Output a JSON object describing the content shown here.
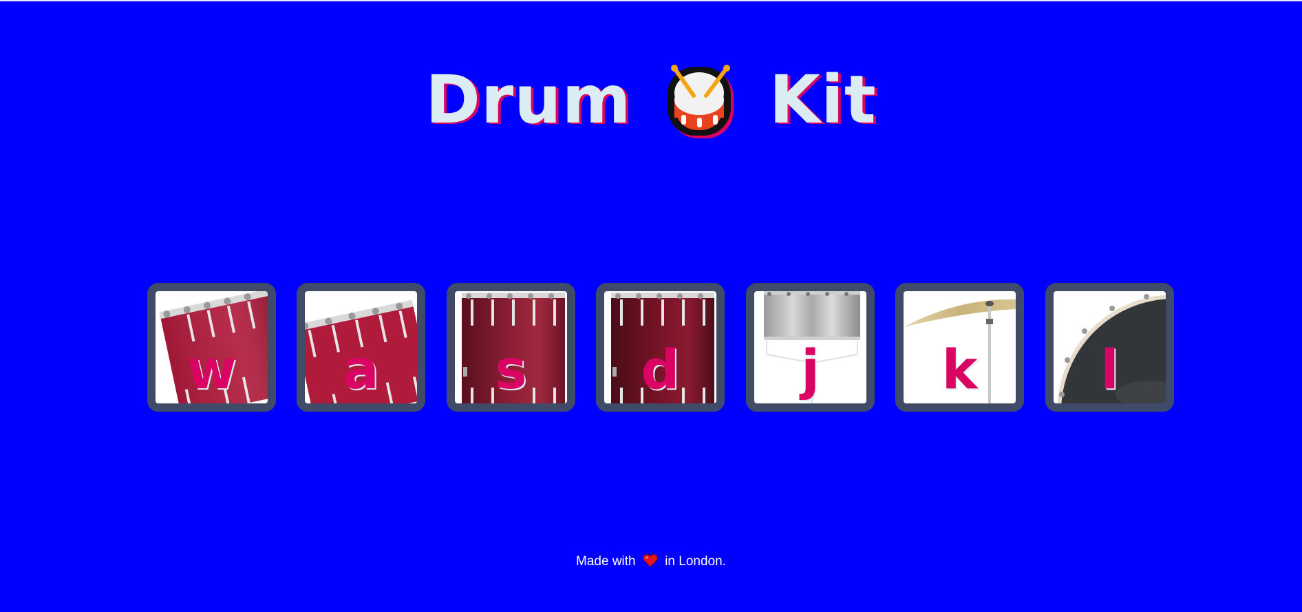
{
  "title": {
    "word1": "Drum",
    "emoji_icon": "drum-emoji-icon",
    "word2": "Kit"
  },
  "drums": [
    {
      "key": "w",
      "icon": "tom-1-icon"
    },
    {
      "key": "a",
      "icon": "tom-2-icon"
    },
    {
      "key": "s",
      "icon": "tom-3-icon"
    },
    {
      "key": "d",
      "icon": "tom-4-icon"
    },
    {
      "key": "j",
      "icon": "snare-icon"
    },
    {
      "key": "k",
      "icon": "crash-cymbal-icon"
    },
    {
      "key": "l",
      "icon": "kick-drum-icon"
    }
  ],
  "footer": {
    "before": "Made with",
    "heart_icon": "heart-icon",
    "after": "in London."
  },
  "colors": {
    "background": "#0000FF",
    "title_text": "#DBEDF3",
    "title_shadow": "#DA0463",
    "key_text": "#DA0463",
    "tile_border": "#404B69",
    "drum_red": "#B01B3C",
    "drum_dark_red": "#7A1428",
    "snare_grey": "#B8B8B8",
    "cymbal_gold": "#CDB785",
    "kick_dark": "#333638"
  }
}
